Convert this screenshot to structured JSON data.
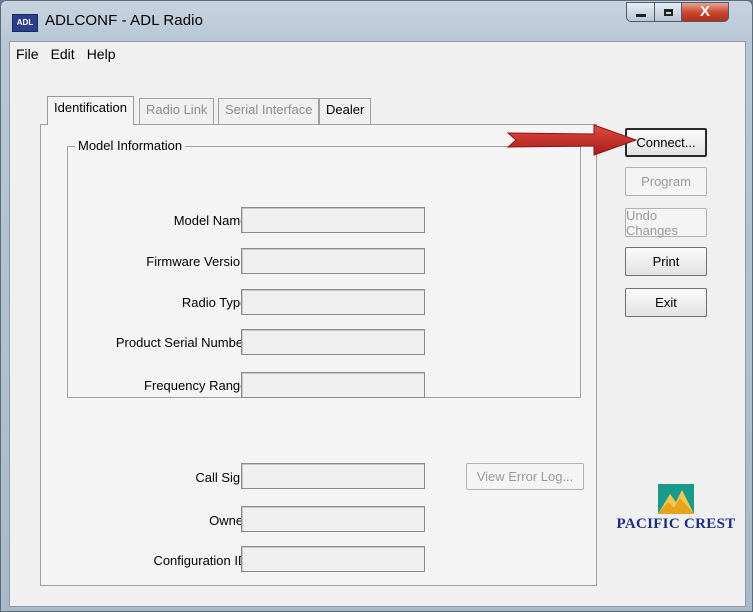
{
  "window": {
    "title": "ADLCONF - ADL Radio",
    "icon_label": "ADL",
    "controls": {
      "minimize": "minimize-icon",
      "maximize": "maximize-icon",
      "close": "X"
    }
  },
  "menu": [
    "File",
    "Edit",
    "Help"
  ],
  "tabs": [
    {
      "label": "Identification",
      "active": true
    },
    {
      "label": "Radio Link",
      "active": false
    },
    {
      "label": "Serial Interface",
      "active": false
    },
    {
      "label": "Dealer",
      "active": false
    }
  ],
  "model_info": {
    "legend": "Model Information",
    "fields": [
      {
        "label": "Model Name:",
        "value": ""
      },
      {
        "label": "Firmware Version:",
        "value": ""
      },
      {
        "label": "Radio Type:",
        "value": ""
      },
      {
        "label": "Product Serial Number:",
        "value": ""
      },
      {
        "label": "Frequency Range:",
        "value": ""
      }
    ]
  },
  "lower_fields": [
    {
      "label": "Call Sign:",
      "value": ""
    },
    {
      "label": "Owner:",
      "value": ""
    },
    {
      "label": "Configuration ID:",
      "value": ""
    }
  ],
  "view_error_log": "View Error Log...",
  "buttons": {
    "connect": "Connect...",
    "program": "Program",
    "undo": "Undo Changes",
    "print": "Print",
    "exit": "Exit"
  },
  "logo": {
    "text": "PACIFIC CREST"
  },
  "colors": {
    "arrow": "#c0282a",
    "logo": "#1d2f80",
    "logo_accent": "#1a9a8a"
  }
}
